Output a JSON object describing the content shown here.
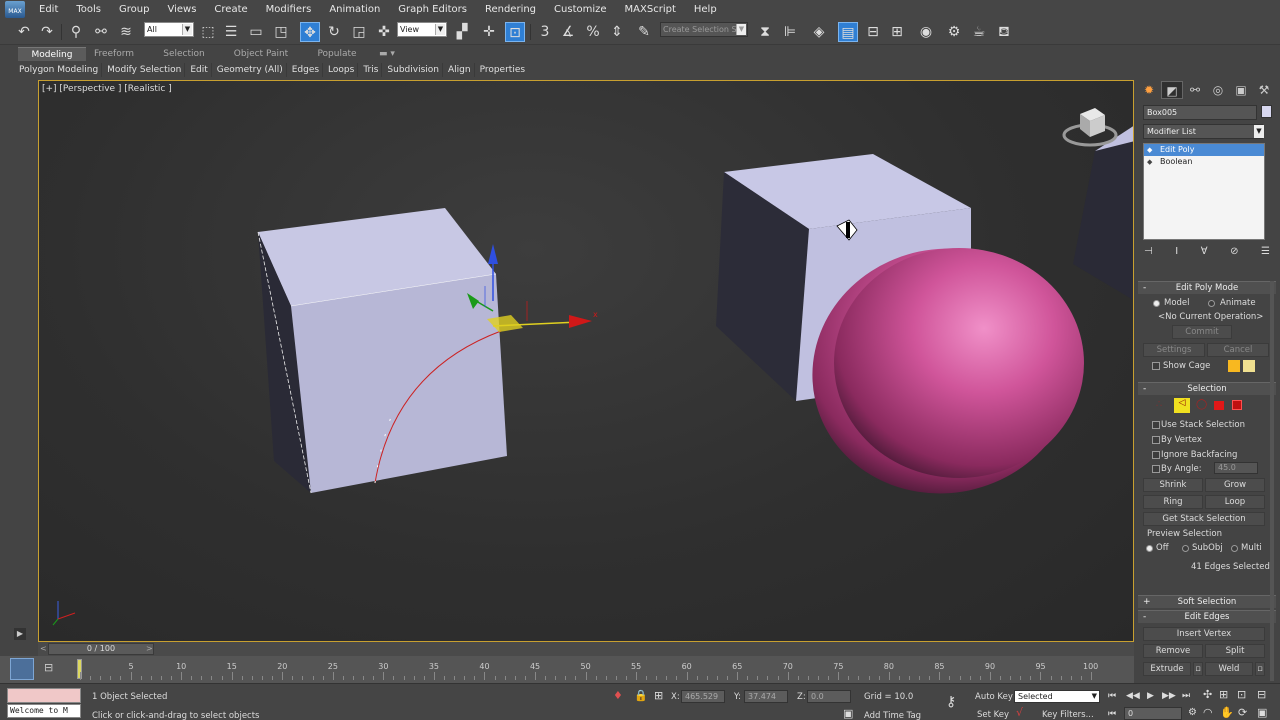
{
  "app": {
    "logo_text": "MAX"
  },
  "menu": [
    "Edit",
    "Tools",
    "Group",
    "Views",
    "Create",
    "Modifiers",
    "Animation",
    "Graph Editors",
    "Rendering",
    "Customize",
    "MAXScript",
    "Help"
  ],
  "toolbar": {
    "selection_filter": "All",
    "ref_coord": "View",
    "named_selection_placeholder": "Create Selection Se",
    "icons": [
      "undo-icon",
      "redo-icon",
      "link-icon",
      "unlink-icon",
      "bind-spacewarp-icon",
      "select-object-icon",
      "select-by-name-icon",
      "rect-selection-icon",
      "window-crossing-icon",
      "move-icon",
      "rotate-icon",
      "scale-icon",
      "place-icon",
      "pivot-icon",
      "snap-3d-icon",
      "angle-snap-icon",
      "percent-snap-icon",
      "spinner-snap-icon",
      "edit-named-sel-icon",
      "mirror-icon",
      "align-icon",
      "layer-icon",
      "scene-explorer-icon",
      "graphite-icon",
      "curve-editor-icon",
      "schematic-icon",
      "material-editor-icon",
      "render-setup-icon",
      "rendered-frame-icon",
      "render-icon"
    ]
  },
  "ribbon": {
    "tabs": [
      "Modeling",
      "Freeform",
      "Selection",
      "Object Paint",
      "Populate"
    ],
    "active_tab": "Modeling",
    "items": [
      "Polygon Modeling",
      "Modify Selection",
      "Edit",
      "Geometry (All)",
      "Edges",
      "Loops",
      "Tris",
      "Subdivision",
      "Align",
      "Properties"
    ]
  },
  "viewport": {
    "label": "[+] [Perspective ] [Realistic ]",
    "gizmo_axis": "x"
  },
  "command_panel": {
    "object_name": "Box005",
    "object_color": "#d8d8f0",
    "modifier_list_label": "Modifier List",
    "stack": [
      {
        "label": "Edit Poly",
        "selected": true
      },
      {
        "label": "Boolean",
        "selected": false
      }
    ],
    "edit_poly_mode": {
      "title": "Edit Poly Mode",
      "model_label": "Model",
      "animate_label": "Animate",
      "current_op": "<No Current Operation>",
      "commit_label": "Commit",
      "settings_label": "Settings",
      "cancel_label": "Cancel",
      "show_cage_label": "Show Cage"
    },
    "selection": {
      "title": "Selection",
      "use_stack_label": "Use Stack Selection",
      "by_vertex_label": "By Vertex",
      "ignore_backfacing_label": "Ignore Backfacing",
      "by_angle_label": "By Angle:",
      "by_angle_value": "45.0",
      "shrink_label": "Shrink",
      "grow_label": "Grow",
      "ring_label": "Ring",
      "loop_label": "Loop",
      "get_stack_label": "Get Stack Selection",
      "preview_title": "Preview Selection",
      "preview_off": "Off",
      "preview_subobj": "SubObj",
      "preview_multi": "Multi",
      "count_text": "41 Edges Selected"
    },
    "soft_selection": {
      "title": "Soft Selection"
    },
    "edit_edges": {
      "title": "Edit Edges",
      "insert_vertex_label": "Insert Vertex",
      "remove_label": "Remove",
      "split_label": "Split",
      "extrude_label": "Extrude",
      "weld_label": "Weld"
    }
  },
  "timeline": {
    "frame_display": "0 / 100",
    "ticks": [
      0,
      5,
      10,
      15,
      20,
      25,
      30,
      35,
      40,
      45,
      50,
      55,
      60,
      65,
      70,
      75,
      80,
      85,
      90,
      95,
      100
    ]
  },
  "status": {
    "maxscript_text": "Welcome to M",
    "selected_text": "1 Object Selected",
    "prompt_text": "Click or click-and-drag to select objects",
    "x_label": "X:",
    "x_value": "465.529",
    "y_label": "Y:",
    "y_value": "37.474",
    "z_label": "Z:",
    "z_value": "0.0",
    "grid_text": "Grid = 10.0",
    "add_time_tag": "Add Time Tag",
    "auto_key": "Auto Key",
    "set_key": "Set Key",
    "key_mode_value": "Selected",
    "key_filters": "Key Filters...",
    "frame_field": "0"
  }
}
